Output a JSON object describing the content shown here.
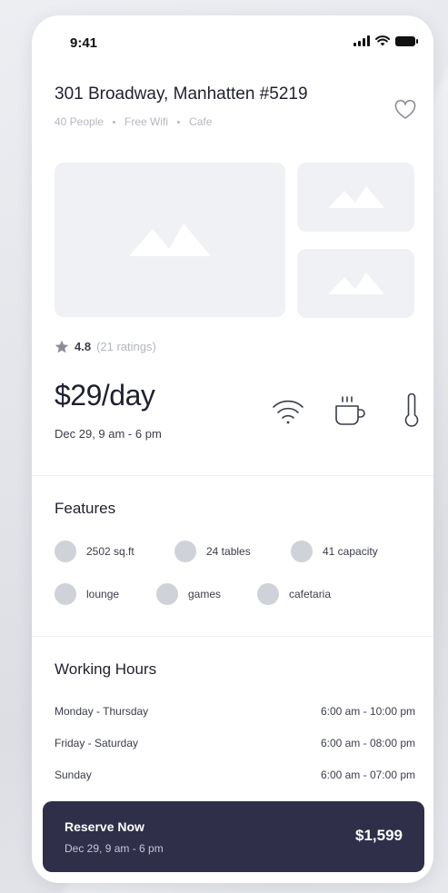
{
  "status_bar": {
    "time": "9:41"
  },
  "listing": {
    "title": "301 Broadway, Manhatten #5219",
    "tags": [
      "40 People",
      "Free Wifi",
      "Cafe"
    ]
  },
  "rating": {
    "value": "4.8",
    "count": "(21 ratings)"
  },
  "pricing": {
    "price": "$29/day",
    "date": "Dec 29, 9 am - 6 pm"
  },
  "amenities": [
    "wifi-icon",
    "coffee-cup-icon",
    "thermometer-icon"
  ],
  "features": {
    "title": "Features",
    "items": [
      {
        "label": "2502 sq.ft"
      },
      {
        "label": "24 tables"
      },
      {
        "label": "41 capacity"
      },
      {
        "label": "lounge"
      },
      {
        "label": "games"
      },
      {
        "label": "cafetaria"
      }
    ]
  },
  "working_hours": {
    "title": "Working Hours",
    "rows": [
      {
        "days": "Monday - Thursday",
        "hours": "6:00 am - 10:00 pm"
      },
      {
        "days": "Friday - Saturday",
        "hours": "6:00 am - 08:00 pm"
      },
      {
        "days": "Sunday",
        "hours": "6:00 am - 07:00 pm"
      }
    ]
  },
  "reserve": {
    "label": "Reserve Now",
    "date": "Dec 29, 9 am - 6 pm",
    "total": "$1,599"
  },
  "colors": {
    "primary_dark": "#2f2f4a",
    "placeholder": "#f0f1f4",
    "muted_text": "#b4b7c0"
  }
}
